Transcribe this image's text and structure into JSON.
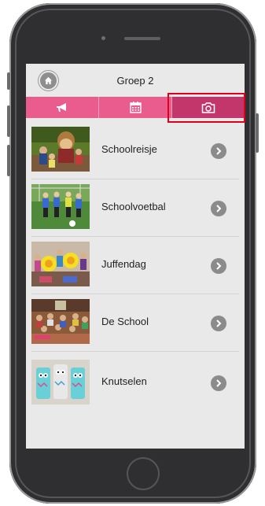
{
  "header": {
    "title": "Groep 2"
  },
  "tabs": [
    {
      "icon": "megaphone-icon",
      "active": false
    },
    {
      "icon": "calendar-icon",
      "active": false
    },
    {
      "icon": "camera-icon",
      "active": true
    }
  ],
  "albums": [
    {
      "label": "Schoolreisje",
      "thumb": "photo-schoolreisje"
    },
    {
      "label": "Schoolvoetbal",
      "thumb": "photo-schoolvoetbal"
    },
    {
      "label": "Juffendag",
      "thumb": "photo-juffendag"
    },
    {
      "label": "De School",
      "thumb": "photo-de-school"
    },
    {
      "label": "Knutselen",
      "thumb": "photo-knutselen"
    }
  ],
  "colors": {
    "tab": "#ea5b8e",
    "tab_active": "#c3366b",
    "highlight": "#e0001b"
  }
}
